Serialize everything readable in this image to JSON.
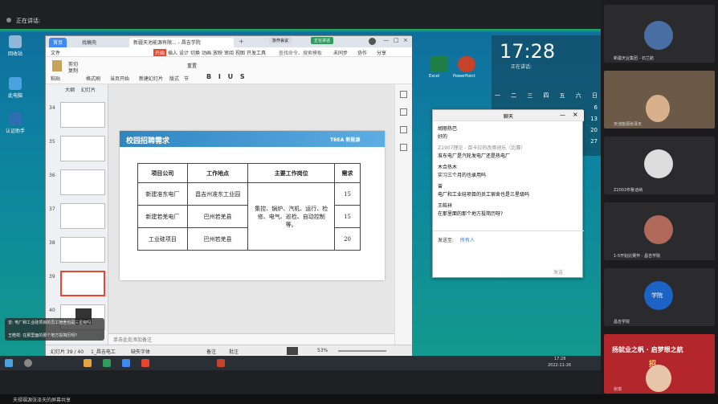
{
  "meeting": {
    "speaking": "正在讲话:",
    "bottom_share": "天禄福源张泽天的屏幕共享"
  },
  "desktop_icons": [
    {
      "label": "回收站",
      "color": "#8fb7d8"
    },
    {
      "label": "此电脑",
      "color": "#4aa3df"
    },
    {
      "label": "认证助手",
      "color": "#2e6db4"
    }
  ],
  "wps": {
    "tabs": {
      "home": "首页",
      "tab2": "找稿壳",
      "doc": "新疆天池能源有限... - 昌吉学院"
    },
    "tab_actions": {
      "share": "协作会议",
      "speaker": "正在讲话"
    },
    "menu": [
      "文件",
      "开始",
      "插入",
      "设计",
      "切换",
      "动画",
      "放映",
      "审阅",
      "视图",
      "开发工具"
    ],
    "search": "查找命令、搜索模板",
    "menu_right": [
      "未同步",
      "协作",
      "分享"
    ],
    "ribbon": {
      "paste": "粘贴",
      "cut": "剪切",
      "copy": "复制",
      "format": "格式刷",
      "play": "当页开始",
      "new_slide": "新建幻灯片",
      "layout": "版式",
      "section": "节",
      "reset": "重置"
    },
    "panel_tabs": [
      "大纲",
      "幻灯片"
    ],
    "slide_numbers": [
      "34",
      "35",
      "36",
      "37",
      "38",
      "39",
      "40"
    ],
    "notes": "单击此处添加备注",
    "status": {
      "slide": "幻灯片 39 / 40",
      "theme": "1_昌吉电工",
      "font": "缺失字体",
      "notes_btn": "备注",
      "comment_btn": "批注",
      "zoom": "53%"
    }
  },
  "slide": {
    "title": "校园招聘需求",
    "brand": "TBEA 新能源",
    "headers": [
      "项目公司",
      "工作地点",
      "主要工作岗位",
      "需求"
    ],
    "rows": [
      {
        "company": "新建准东电厂",
        "place": "昌吉州准东工业园",
        "count": "15"
      },
      {
        "company": "新建若羌电厂",
        "place": "巴州若羌县",
        "count": "15"
      },
      {
        "company": "工业硅项目",
        "place": "巴州若羌县",
        "count": "20"
      }
    ],
    "positions": "集控、锅炉、汽机、运行、检修、电气、巡检、自动控制等。"
  },
  "desktop": {
    "clock": "17:28",
    "speaking": "正在讲话:",
    "apps": [
      "Excel",
      "PowerPoint"
    ],
    "calendar": [
      [
        "一",
        "二",
        "三",
        "四",
        "五",
        "六",
        "日"
      ],
      [
        "",
        "",
        "",
        "",
        "",
        "",
        "6"
      ],
      [
        "",
        "",
        "",
        "",
        "",
        "",
        "13"
      ],
      [
        "",
        "",
        "",
        "",
        "",
        "",
        "20"
      ],
      [
        "",
        "",
        "",
        "",
        "",
        "",
        "27"
      ]
    ]
  },
  "chat": {
    "title": "聊天",
    "messages": [
      {
        "name": "胡丽热巴",
        "text": "好的",
        "name_color": "#2a7ae2"
      },
      {
        "name": "Z1907理论 - 苗卡拉热孜奥迪乐（比赛）",
        "text": "准东电厂是汽轮发电厂还是热电厂",
        "name_color": "#8a8a8a"
      },
      {
        "name": "木合热木",
        "text": "实习三个月的也录用吗",
        "name_color": "#2a7ae2"
      },
      {
        "name": "曾",
        "text": "电厂和工业硅项目的员工宿舍也是三星级吗",
        "name_color": "#2a7ae2"
      },
      {
        "name": "王皓祥",
        "text": "在那里面的那个地方投简历呀?",
        "name_color": "#2a7ae2"
      }
    ],
    "send_to": "发送至:",
    "recipient": "所有人",
    "send": "发送"
  },
  "left_bubble": {
    "line1": "曾: 电厂和工业硅项目的员工宿舍也是三星级吗",
    "line2": "王皓祥: 在那里面的那个地方投简历呀?"
  },
  "taskbar": {
    "time": "17:28",
    "date": "2022-11-26"
  },
  "participants": [
    {
      "name": "新疆天业集团 - 石兰航",
      "color": "#3a3a3e"
    },
    {
      "name": "天池能源张泽天",
      "color": "#6b5a48"
    },
    {
      "name": "Z2002布鲁迪纳",
      "color": "#3a3a3e"
    },
    {
      "name": "1-5开始比赛怀 - 昌吉学院",
      "color": "#3a3a3e"
    },
    {
      "name": "昌吉学院",
      "color": "#2b2b2e"
    },
    {
      "name": "张琪",
      "color": "#b3262b"
    }
  ],
  "recruit_banner": {
    "line1": "扬就业之帆 · 启梦想之航",
    "line2": "招"
  },
  "logo_text": "学院"
}
